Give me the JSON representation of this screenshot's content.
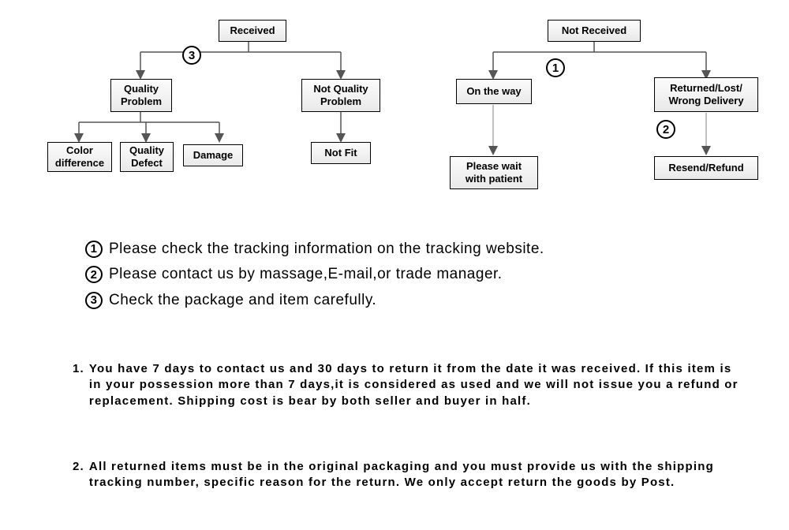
{
  "flow": {
    "received": "Received",
    "not_received": "Not  Received",
    "quality_problem": "Quality\nProblem",
    "not_quality_problem": "Not Quality\nProblem",
    "color_difference": "Color\ndifference",
    "quality_defect": "Quality\nDefect",
    "damage": "Damage",
    "not_fit": "Not Fit",
    "on_the_way": "On the way",
    "returned_lost": "Returned/Lost/\nWrong Delivery",
    "please_wait": "Please wait\nwith patient",
    "resend_refund": "Resend/Refund",
    "badge1": "1",
    "badge2": "2",
    "badge3": "3"
  },
  "instructions": {
    "n1": "1",
    "t1": "Please check the tracking information on the tracking website.",
    "n2": "2",
    "t2": "Please contact us by  massage,E-mail,or trade manager.",
    "n3": "3",
    "t3": "Check the package and item carefully."
  },
  "policy": {
    "p1_num": "1.",
    "p1_text": "You have 7 days to contact us and 30 days to return it from the date it was received. If this item is in your possession more than 7 days,it is considered as used and we will not issue you a refund or replacement. Shipping cost is bear by both seller and buyer in half.",
    "p2_num": "2.",
    "p2_text": "All returned items must be in the original packaging and you must provide us with the shipping tracking number, specific reason for the return. We only accept return the goods by Post."
  }
}
